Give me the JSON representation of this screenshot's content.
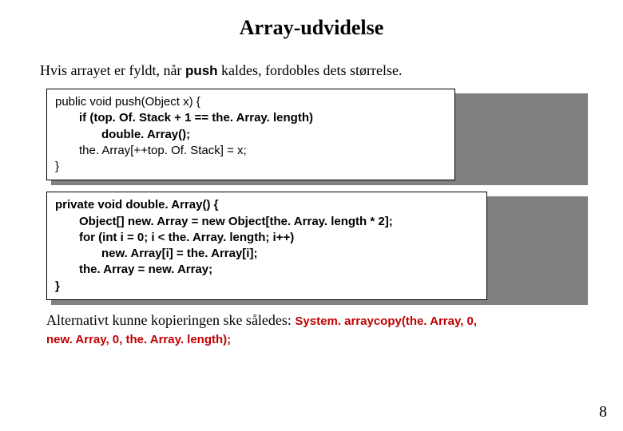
{
  "title": "Array-udvidelse",
  "intro_part1": "Hvis arrayet er fyldt, når ",
  "intro_kw": "push",
  "intro_part2": " kaldes, fordobles dets størrelse.",
  "code1": {
    "l1": "public void push(Object x) {",
    "l2": "if (top. Of. Stack + 1 == the. Array. length)",
    "l3": "double. Array();",
    "l4": "the. Array[++top. Of. Stack] = x;",
    "l5": "}"
  },
  "code2": {
    "l1a": "private void ",
    "l1b": "double. Array",
    "l1c": "() {",
    "l2": "Object[] new. Array = new Object[the. Array. length * 2];",
    "l3": "for (int i = 0; i < the. Array. length; i++)",
    "l4": "new. Array[i] = the. Array[i];",
    "l5": "the. Array = new. Array;",
    "l6": "}"
  },
  "alt_text": "Alternativt kunne kopieringen ske således: ",
  "alt_code1": "System. arraycopy(the. Array, 0,",
  "alt_code2": "new. Array, 0, the. Array. length);",
  "page_number": "8"
}
